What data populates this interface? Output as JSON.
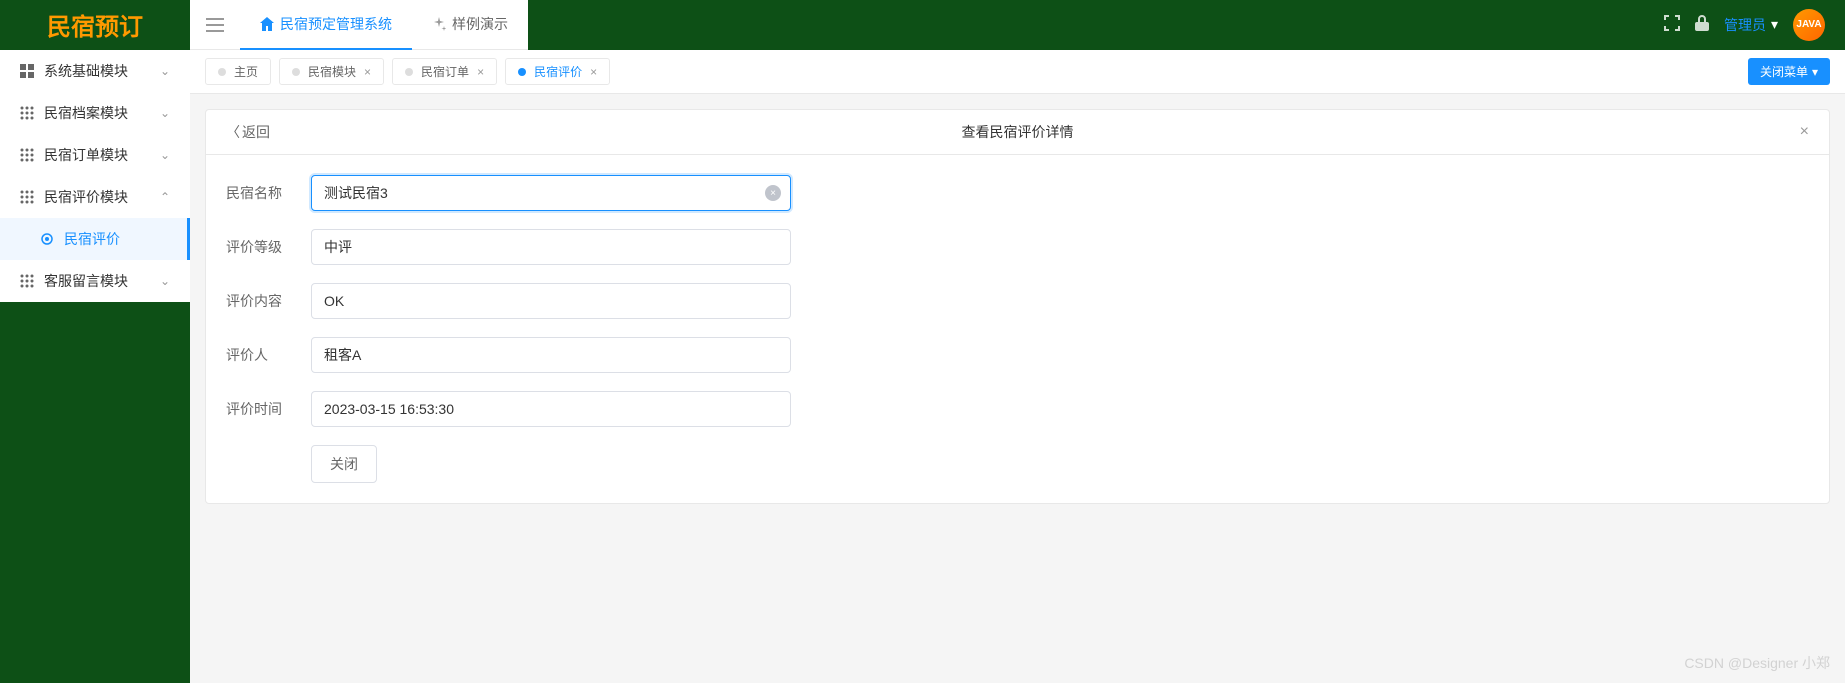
{
  "logo": "民宿预订",
  "header": {
    "top_tabs": [
      {
        "label": "民宿预定管理系统",
        "active": true,
        "icon": "home"
      },
      {
        "label": "样例演示",
        "active": false,
        "icon": "sparkle"
      }
    ],
    "admin_label": "管理员",
    "avatar_text": "JAVA"
  },
  "sidebar": {
    "items": [
      {
        "label": "系统基础模块",
        "icon": "dashboard",
        "expanded": false
      },
      {
        "label": "民宿档案模块",
        "icon": "grid",
        "expanded": false
      },
      {
        "label": "民宿订单模块",
        "icon": "grid",
        "expanded": false
      },
      {
        "label": "民宿评价模块",
        "icon": "grid",
        "expanded": true
      },
      {
        "label": "客服留言模块",
        "icon": "grid",
        "expanded": false
      }
    ],
    "submenu": {
      "label": "民宿评价",
      "icon": "target"
    }
  },
  "tabs": {
    "items": [
      {
        "label": "主页",
        "closable": false,
        "active": false
      },
      {
        "label": "民宿模块",
        "closable": true,
        "active": false
      },
      {
        "label": "民宿订单",
        "closable": true,
        "active": false
      },
      {
        "label": "民宿评价",
        "closable": true,
        "active": true
      }
    ],
    "close_menu": "关闭菜单"
  },
  "panel": {
    "back": "返回",
    "title": "查看民宿评价详情",
    "form": {
      "fields": [
        {
          "label": "民宿名称",
          "value": "测试民宿3",
          "focused": true,
          "clearable": true
        },
        {
          "label": "评价等级",
          "value": "中评",
          "focused": false,
          "clearable": false
        },
        {
          "label": "评价内容",
          "value": "OK",
          "focused": false,
          "clearable": false
        },
        {
          "label": "评价人",
          "value": "租客A",
          "focused": false,
          "clearable": false
        },
        {
          "label": "评价时间",
          "value": "2023-03-15 16:53:30",
          "focused": false,
          "clearable": false
        }
      ],
      "close_btn": "关闭"
    }
  },
  "watermark": "CSDN @Designer 小郑"
}
